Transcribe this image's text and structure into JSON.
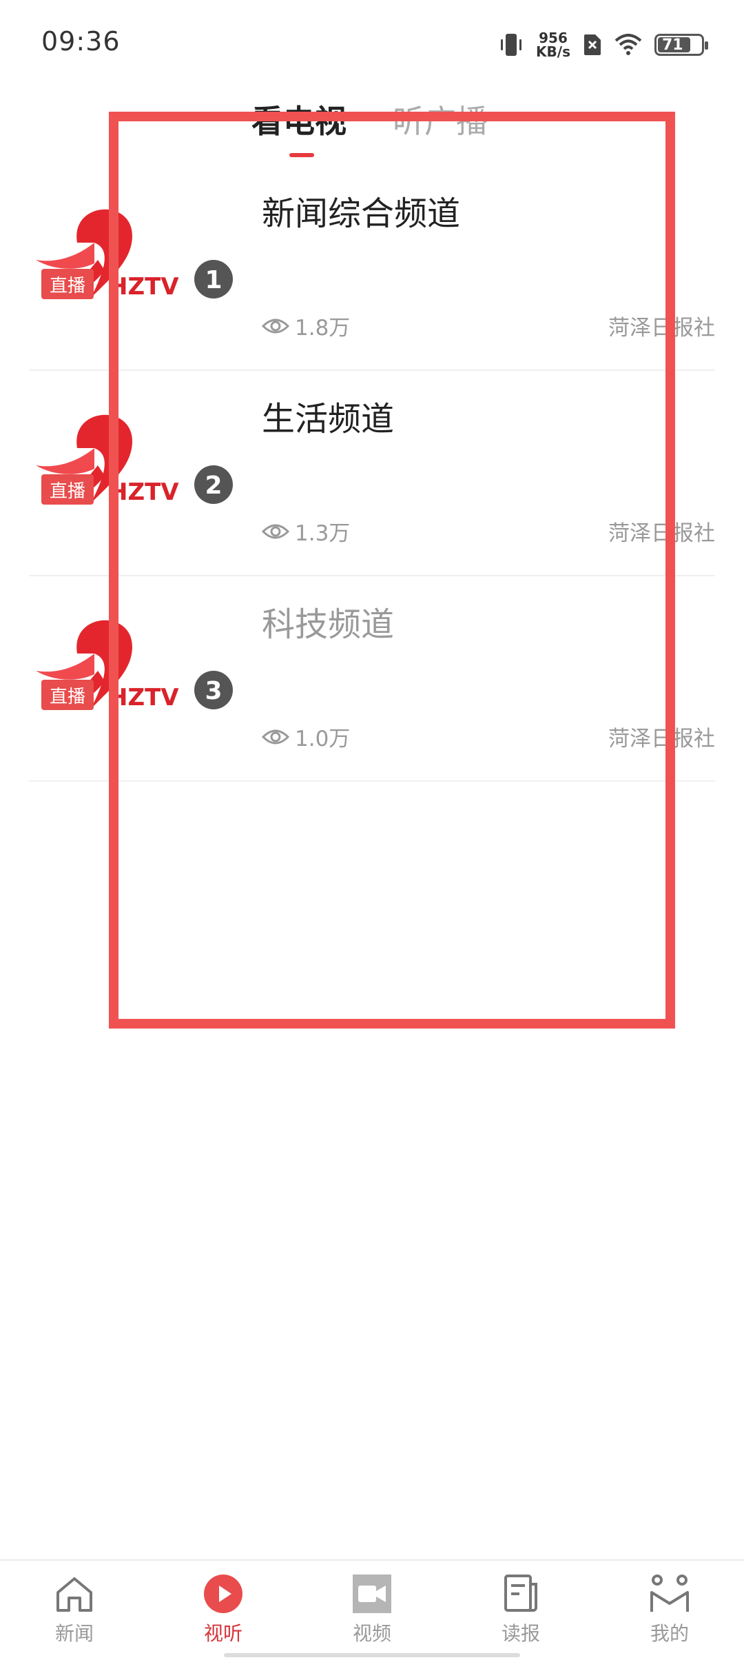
{
  "status_bar": {
    "time": "09:36",
    "net_speed_value": "956",
    "net_speed_unit": "KB/s",
    "battery": "71",
    "icons": [
      "vibrate-icon",
      "no-sim-icon",
      "wifi-icon",
      "battery-icon"
    ]
  },
  "tabs": [
    {
      "label": "看电视",
      "active": true
    },
    {
      "label": "听广播",
      "active": false
    }
  ],
  "channels": [
    {
      "title": "新闻综合频道",
      "views": "1.8万",
      "publisher": "菏泽日报社",
      "badge": "直播",
      "logo_number": "1"
    },
    {
      "title": "生活频道",
      "views": "1.3万",
      "publisher": "菏泽日报社",
      "badge": "直播",
      "logo_number": "2"
    },
    {
      "title": "科技频道",
      "views": "1.0万",
      "publisher": "菏泽日报社",
      "badge": "直播",
      "logo_number": "3"
    }
  ],
  "logo_text": "HZTV",
  "bottom_nav": [
    {
      "label": "新闻",
      "icon": "home-icon",
      "active": false
    },
    {
      "label": "视听",
      "icon": "play-circle-icon",
      "active": true
    },
    {
      "label": "视频",
      "icon": "video-camera-icon",
      "active": false
    },
    {
      "label": "读报",
      "icon": "newspaper-icon",
      "active": false
    },
    {
      "label": "我的",
      "icon": "profile-icon",
      "active": false
    }
  ],
  "colors": {
    "accent": "#e53a3f",
    "badge": "#e84c4c",
    "highlight": "#f05252",
    "muted_text": "#999999"
  }
}
